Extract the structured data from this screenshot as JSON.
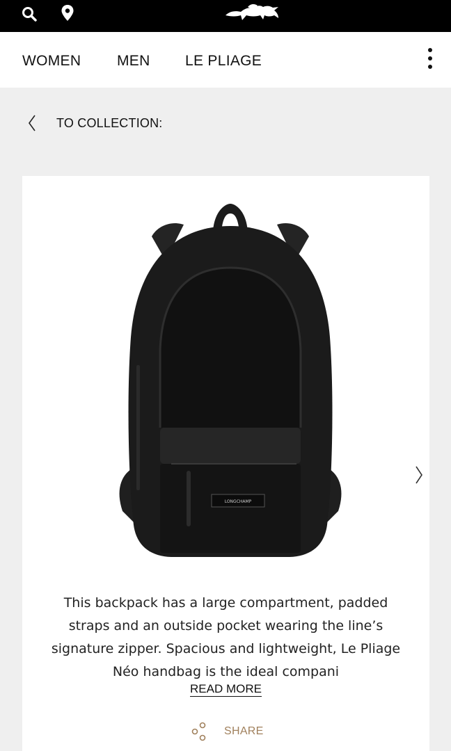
{
  "header": {
    "icons": [
      "search-icon",
      "location-pin-icon",
      "brand-horse-logo"
    ],
    "background": "#000000"
  },
  "nav": {
    "items": [
      {
        "label": "WOMEN"
      },
      {
        "label": "MEN"
      },
      {
        "label": "LE PLIAGE"
      }
    ],
    "menu_icon": "more-vertical-icon"
  },
  "breadcrumb": {
    "back_label": "TO COLLECTION:"
  },
  "product": {
    "image_label": "LONGCHAMP",
    "description": "This backpack has a large compartment, padded straps and an outside pocket wearing the line’s signature zipper. Spacious and lightweight, Le Pliage Néo handbag is the ideal compani",
    "read_more": "READ MORE",
    "share": "SHARE"
  },
  "colors": {
    "accent_share": "#a0805c",
    "page_bg": "#efefef"
  }
}
